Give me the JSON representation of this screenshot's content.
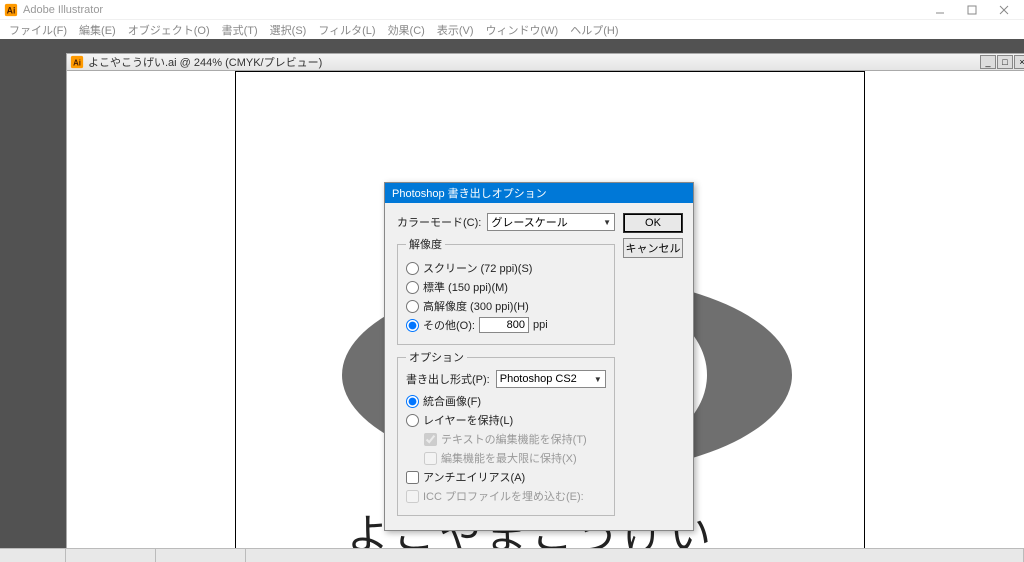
{
  "app": {
    "title": "Adobe Illustrator",
    "menus": [
      "ファイル(F)",
      "編集(E)",
      "オブジェクト(O)",
      "書式(T)",
      "選択(S)",
      "フィルタ(L)",
      "効果(C)",
      "表示(V)",
      "ウィンドウ(W)",
      "ヘルプ(H)"
    ]
  },
  "document": {
    "title": "よこやこうげい.ai @ 244% (CMYK/プレビュー)",
    "canvas_text": "よこやまこうげい"
  },
  "dialog": {
    "title": "Photoshop 書き出しオプション",
    "color_mode_label": "カラーモード(C):",
    "color_mode_value": "グレースケール",
    "resolution_legend": "解像度",
    "res_screen": "スクリーン (72 ppi)(S)",
    "res_medium": "標準 (150 ppi)(M)",
    "res_high": "高解像度 (300 ppi)(H)",
    "res_other": "その他(O):",
    "res_other_value": "800",
    "res_unit": "ppi",
    "options_legend": "オプション",
    "export_format_label": "書き出し形式(P):",
    "export_format_value": "Photoshop CS2",
    "opt_flat": "統合画像(F)",
    "opt_layers": "レイヤーを保持(L)",
    "opt_text_edit": "テキストの編集機能を保持(T)",
    "opt_max_edit": "編集機能を最大限に保持(X)",
    "opt_antialias": "アンチエイリアス(A)",
    "opt_icc": "ICC プロファイルを埋め込む(E):",
    "ok": "OK",
    "cancel": "キャンセル"
  },
  "statusbar": {
    "zoom_or_tool": ""
  }
}
